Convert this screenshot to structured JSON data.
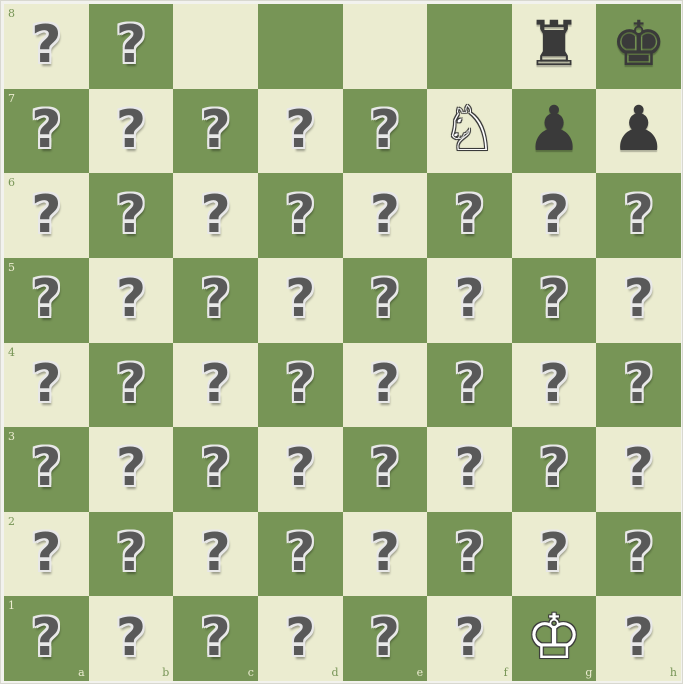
{
  "board": {
    "files": [
      "a",
      "b",
      "c",
      "d",
      "e",
      "f",
      "g",
      "h"
    ],
    "ranks": [
      "8",
      "7",
      "6",
      "5",
      "4",
      "3",
      "2",
      "1"
    ],
    "colors": {
      "light": "#ebecd0",
      "dark": "#779556"
    },
    "squares": {
      "8": [
        {
          "type": "unknown",
          "glyph": "?"
        },
        {
          "type": "unknown",
          "glyph": "?"
        },
        {
          "type": "empty",
          "glyph": ""
        },
        {
          "type": "empty",
          "glyph": ""
        },
        {
          "type": "empty",
          "glyph": ""
        },
        {
          "type": "empty",
          "glyph": ""
        },
        {
          "type": "black-rook",
          "glyph": "♜"
        },
        {
          "type": "black-king",
          "glyph": "♚"
        }
      ],
      "7": [
        {
          "type": "unknown",
          "glyph": "?"
        },
        {
          "type": "unknown",
          "glyph": "?"
        },
        {
          "type": "unknown",
          "glyph": "?"
        },
        {
          "type": "unknown",
          "glyph": "?"
        },
        {
          "type": "unknown",
          "glyph": "?"
        },
        {
          "type": "white-knight",
          "glyph": "♘"
        },
        {
          "type": "black-pawn",
          "glyph": "♟"
        },
        {
          "type": "black-pawn",
          "glyph": "♟"
        }
      ],
      "6": [
        {
          "type": "unknown",
          "glyph": "?"
        },
        {
          "type": "unknown",
          "glyph": "?"
        },
        {
          "type": "unknown",
          "glyph": "?"
        },
        {
          "type": "unknown",
          "glyph": "?"
        },
        {
          "type": "unknown",
          "glyph": "?"
        },
        {
          "type": "unknown",
          "glyph": "?"
        },
        {
          "type": "unknown",
          "glyph": "?"
        },
        {
          "type": "unknown",
          "glyph": "?"
        }
      ],
      "5": [
        {
          "type": "unknown",
          "glyph": "?"
        },
        {
          "type": "unknown",
          "glyph": "?"
        },
        {
          "type": "unknown",
          "glyph": "?"
        },
        {
          "type": "unknown",
          "glyph": "?"
        },
        {
          "type": "unknown",
          "glyph": "?"
        },
        {
          "type": "unknown",
          "glyph": "?"
        },
        {
          "type": "unknown",
          "glyph": "?"
        },
        {
          "type": "unknown",
          "glyph": "?"
        }
      ],
      "4": [
        {
          "type": "unknown",
          "glyph": "?"
        },
        {
          "type": "unknown",
          "glyph": "?"
        },
        {
          "type": "unknown",
          "glyph": "?"
        },
        {
          "type": "unknown",
          "glyph": "?"
        },
        {
          "type": "unknown",
          "glyph": "?"
        },
        {
          "type": "unknown",
          "glyph": "?"
        },
        {
          "type": "unknown",
          "glyph": "?"
        },
        {
          "type": "unknown",
          "glyph": "?"
        }
      ],
      "3": [
        {
          "type": "unknown",
          "glyph": "?"
        },
        {
          "type": "unknown",
          "glyph": "?"
        },
        {
          "type": "unknown",
          "glyph": "?"
        },
        {
          "type": "unknown",
          "glyph": "?"
        },
        {
          "type": "unknown",
          "glyph": "?"
        },
        {
          "type": "unknown",
          "glyph": "?"
        },
        {
          "type": "unknown",
          "glyph": "?"
        },
        {
          "type": "unknown",
          "glyph": "?"
        }
      ],
      "2": [
        {
          "type": "unknown",
          "glyph": "?"
        },
        {
          "type": "unknown",
          "glyph": "?"
        },
        {
          "type": "unknown",
          "glyph": "?"
        },
        {
          "type": "unknown",
          "glyph": "?"
        },
        {
          "type": "unknown",
          "glyph": "?"
        },
        {
          "type": "unknown",
          "glyph": "?"
        },
        {
          "type": "unknown",
          "glyph": "?"
        },
        {
          "type": "unknown",
          "glyph": "?"
        }
      ],
      "1": [
        {
          "type": "unknown",
          "glyph": "?"
        },
        {
          "type": "unknown",
          "glyph": "?"
        },
        {
          "type": "unknown",
          "glyph": "?"
        },
        {
          "type": "unknown",
          "glyph": "?"
        },
        {
          "type": "unknown",
          "glyph": "?"
        },
        {
          "type": "unknown",
          "glyph": "?"
        },
        {
          "type": "white-king",
          "glyph": "♔"
        },
        {
          "type": "unknown",
          "glyph": "?"
        }
      ]
    }
  }
}
